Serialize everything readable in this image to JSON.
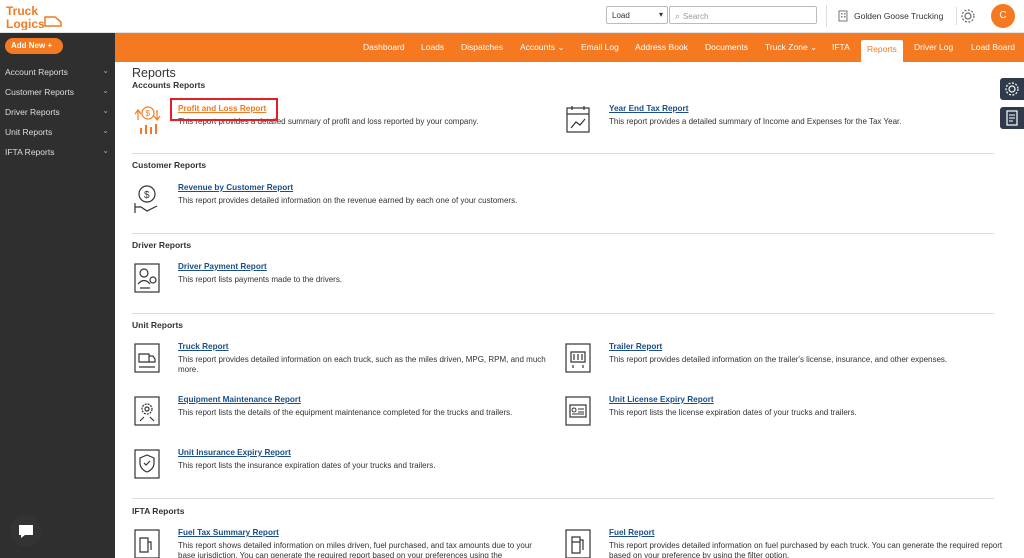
{
  "app": {
    "logo_text_top": "Truck",
    "logo_text_bottom": "Logics",
    "company": "Golden Goose Trucking",
    "avatar_letter": "C",
    "accent_color": "#f47920",
    "sidebar_bg": "#2f2f2f"
  },
  "topbar": {
    "load_select": "Load",
    "search_placeholder": "Search"
  },
  "sidebar": {
    "add_new": "Add New",
    "items": [
      {
        "label": "Account Reports"
      },
      {
        "label": "Customer Reports"
      },
      {
        "label": "Driver Reports"
      },
      {
        "label": "Unit Reports"
      },
      {
        "label": "IFTA Reports"
      }
    ]
  },
  "nav": {
    "items": [
      {
        "label": "Dashboard"
      },
      {
        "label": "Loads"
      },
      {
        "label": "Dispatches"
      },
      {
        "label": "Accounts"
      },
      {
        "label": "Email Log"
      },
      {
        "label": "Address Book"
      },
      {
        "label": "Documents"
      },
      {
        "label": "Truck Zone"
      },
      {
        "label": "IFTA"
      },
      {
        "label": "Reports"
      },
      {
        "label": "Driver Log"
      },
      {
        "label": "Load Board"
      }
    ]
  },
  "main": {
    "title": "Reports",
    "sections": {
      "accounts": "Accounts Reports",
      "customer": "Customer Reports",
      "driver": "Driver Reports",
      "unit": "Unit Reports",
      "ifta": "IFTA Reports"
    },
    "reports": {
      "pnl": {
        "title": "Profit and Loss Report",
        "desc": "This report provides a detailed summary of profit and loss reported by your company.",
        "icon": "profit-loss-icon"
      },
      "yearend": {
        "title": "Year End Tax Report",
        "desc": "This report provides a detailed summary of Income and Expenses for the Tax Year.",
        "icon": "calendar-icon"
      },
      "revenue": {
        "title": "Revenue by Customer Report",
        "desc": "This report provides detailed information on the revenue earned by each one of your customers.",
        "icon": "revenue-icon"
      },
      "driverpay": {
        "title": "Driver Payment Report",
        "desc": "This report lists payments made to the drivers.",
        "icon": "driver-payment-icon"
      },
      "truck": {
        "title": "Truck Report",
        "desc": "This report provides detailed information on each truck, such as the miles driven, MPG, RPM, and much more.",
        "icon": "truck-icon"
      },
      "trailer": {
        "title": "Trailer Report",
        "desc": "This report provides detailed information on the trailer's license, insurance, and other expenses.",
        "icon": "trailer-icon"
      },
      "equip": {
        "title": "Equipment Maintenance Report",
        "desc": "This report lists the details of the equipment maintenance completed for the trucks and trailers.",
        "icon": "maintenance-icon"
      },
      "license": {
        "title": "Unit License Expiry Report",
        "desc": "This report lists the license expiration dates of your trucks and trailers.",
        "icon": "license-icon"
      },
      "insurance": {
        "title": "Unit Insurance Expiry Report",
        "desc": "This report lists the insurance expiration dates of your trucks and trailers.",
        "icon": "insurance-icon"
      },
      "fueltax": {
        "title": "Fuel Tax Summary Report",
        "desc": "This report shows detailed information on miles driven, fuel purchased, and tax amounts due to your base jurisdiction. You can generate the required report based on your preferences using the",
        "icon": "fuel-tax-icon"
      },
      "fuel": {
        "title": "Fuel Report",
        "desc": "This report provides detailed information on fuel purchased by each truck. You can generate the required report based on your preference by using the filter option.",
        "icon": "fuel-icon"
      }
    }
  }
}
